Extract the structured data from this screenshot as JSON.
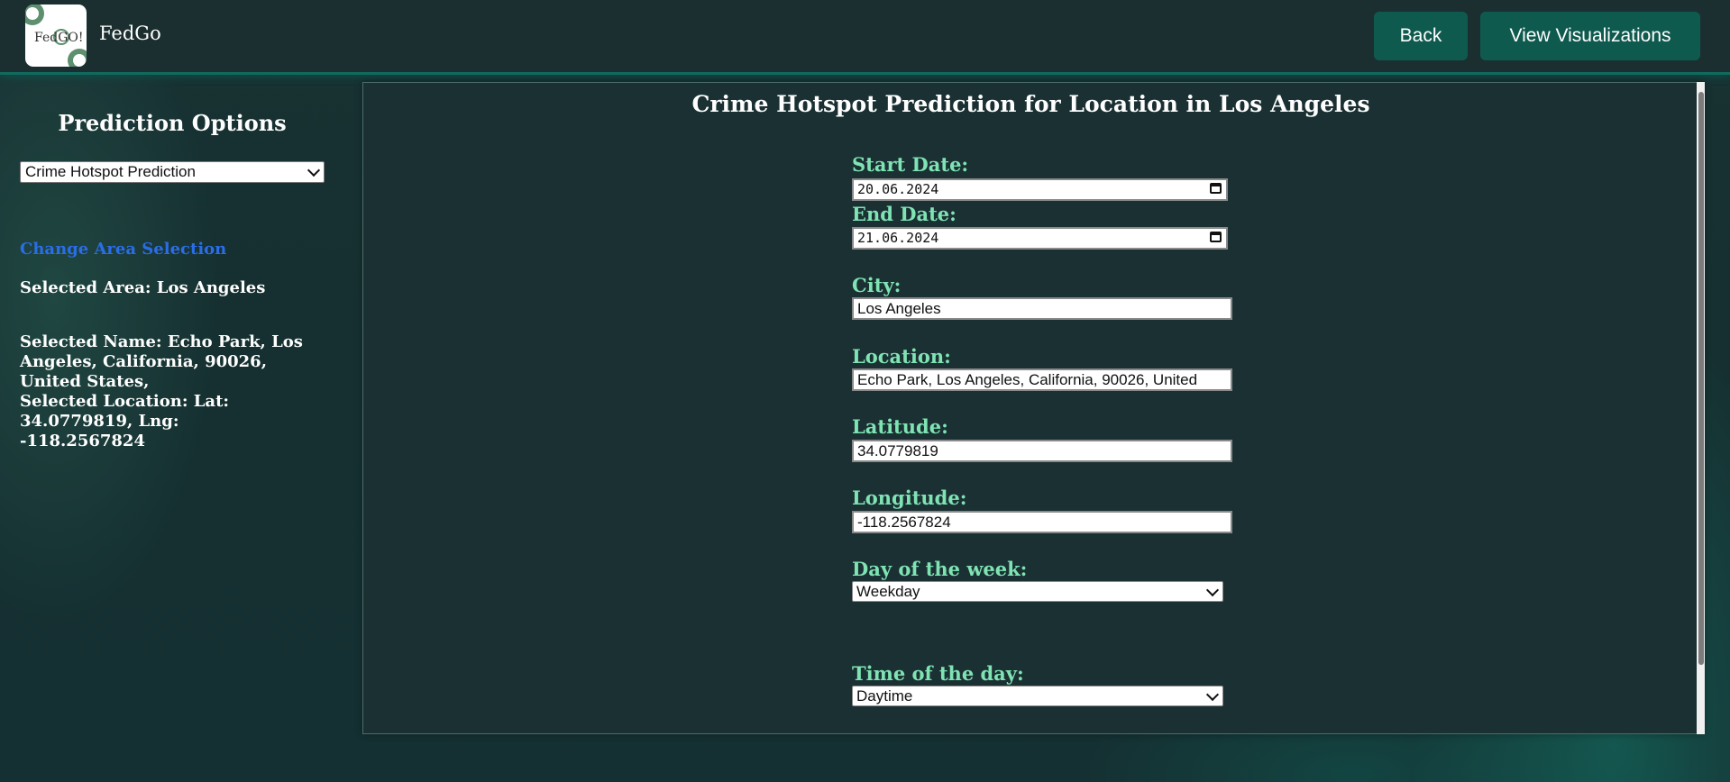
{
  "header": {
    "logo_text": "FedGO!",
    "brand": "FedGo",
    "back_label": "Back",
    "viz_label": "View Visualizations"
  },
  "sidebar": {
    "title": "Prediction Options",
    "prediction_select": {
      "selected": "Crime Hotspot Prediction"
    },
    "change_area_link": "Change Area Selection",
    "selected_area": "Selected Area: Los Angeles",
    "selected_name": "Selected Name: Echo Park, Los Angeles, California, 90026, United States,",
    "selected_location": "Selected Location: Lat: 34.0779819, Lng: -118.2567824"
  },
  "main": {
    "title": "Crime Hotspot Prediction for Location in Los Angeles",
    "start_date": {
      "label": "Start Date:",
      "value": "20.06.2024"
    },
    "end_date": {
      "label": "End Date:",
      "value": "21.06.2024"
    },
    "city": {
      "label": "City:",
      "value": "Los Angeles"
    },
    "location": {
      "label": "Location:",
      "value": "Echo Park, Los Angeles, California, 90026, United"
    },
    "latitude": {
      "label": "Latitude:",
      "value": "34.0779819"
    },
    "longitude": {
      "label": "Longitude:",
      "value": "-118.2567824"
    },
    "day_of_week": {
      "label": "Day of the week:",
      "selected": "Weekday"
    },
    "time_of_day": {
      "label": "Time of the day:",
      "selected": "Daytime"
    }
  },
  "colors": {
    "accent_green": "#7fe3b4",
    "button_bg": "#0f5a4f",
    "link_blue": "#2a6de8",
    "panel_bg": "#1a3032"
  }
}
